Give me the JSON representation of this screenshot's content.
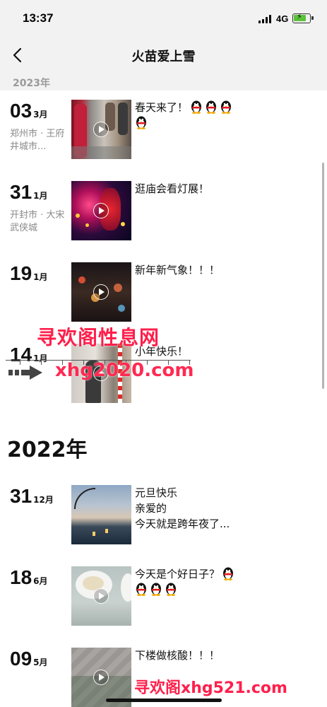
{
  "status_bar": {
    "time": "13:37",
    "network": "4G"
  },
  "nav": {
    "title": "火苗爱上雪"
  },
  "sticky_year": "2023年",
  "entries_2023": [
    {
      "day": "03",
      "month": "3月",
      "location": "郑州市 · 王府井城市...",
      "text": "春天来了！",
      "penguins_inline": 3,
      "penguins_wrap": 1
    },
    {
      "day": "31",
      "month": "1月",
      "location": "开封市 · 大宋武侠城",
      "text": "逛庙会看灯展！"
    },
    {
      "day": "19",
      "month": "1月",
      "location": "",
      "text": "新年新气象！！！"
    },
    {
      "day": "14",
      "month": "1月",
      "location": "",
      "text": "小年快乐！"
    }
  ],
  "year_2022_header": "2022年",
  "entries_2022": [
    {
      "day": "31",
      "month": "12月",
      "location": "",
      "text": "元旦快乐\n亲爱的\n今天就是跨年夜了..."
    },
    {
      "day": "18",
      "month": "6月",
      "location": "",
      "text": "今天是个好日子？",
      "penguins_inline": 1,
      "penguins_wrap": 3
    },
    {
      "day": "09",
      "month": "5月",
      "location": "",
      "text": "下楼做核酸！！！"
    }
  ],
  "watermarks": {
    "line1": "寻欢阁性息网",
    "line2": "xhg2020.com",
    "line3": "寻欢阁xhg521.com"
  },
  "colors": {
    "bar_bg": "#f2f2f2",
    "muted": "#8a8a8a",
    "watermark": "#ff1f4b"
  }
}
